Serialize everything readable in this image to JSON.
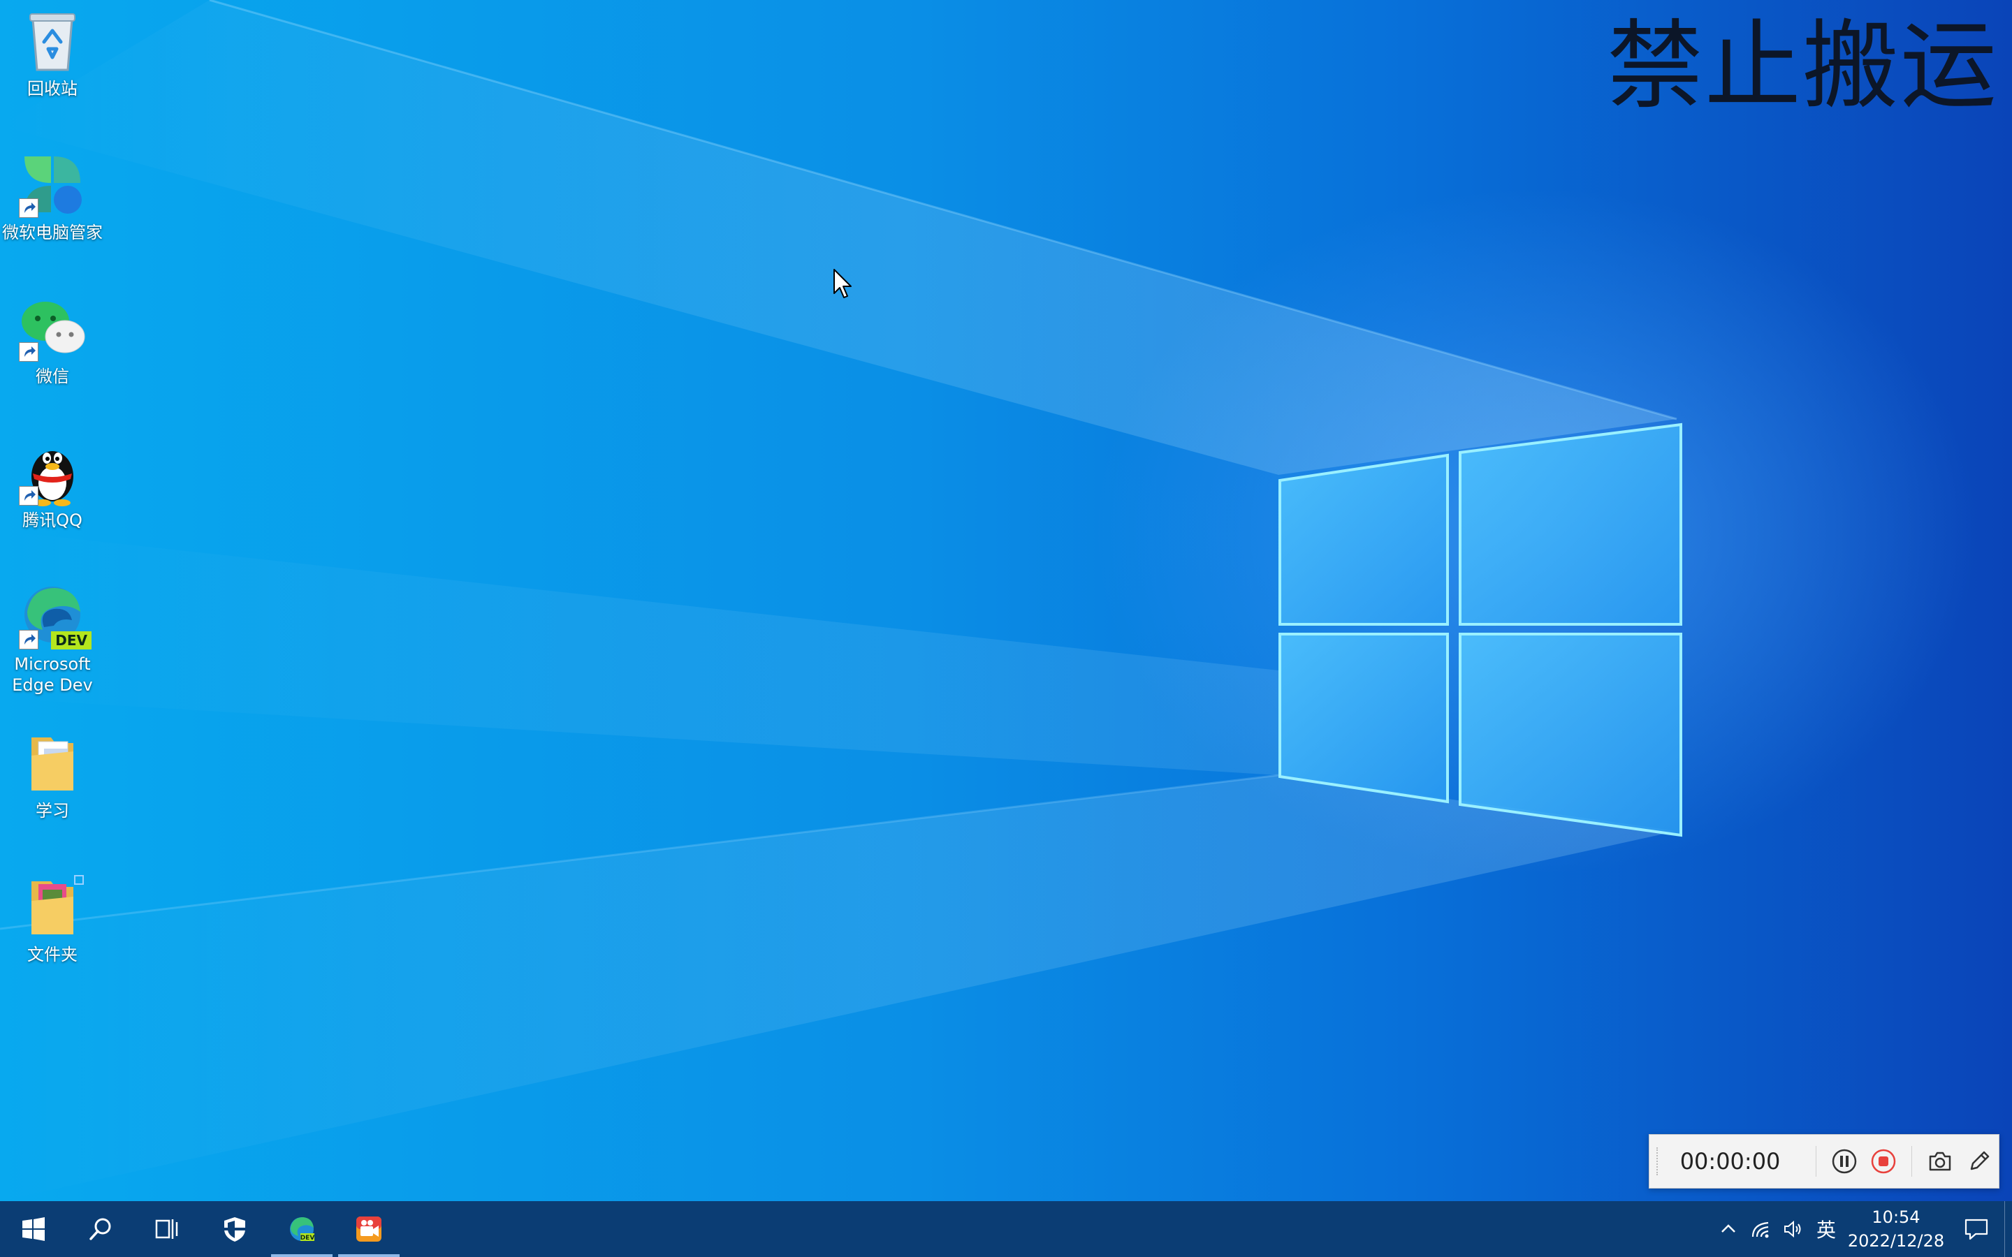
{
  "watermark": "禁止搬运",
  "desktop_icons": [
    {
      "label": "回收站",
      "icon": "recycle-bin-icon",
      "shortcut": false
    },
    {
      "label": "微软电脑管家",
      "icon": "pc-manager-icon",
      "shortcut": true
    },
    {
      "label": "微信",
      "icon": "wechat-icon",
      "shortcut": true
    },
    {
      "label": "腾讯QQ",
      "icon": "qq-penguin-icon",
      "shortcut": true
    },
    {
      "label": "Microsoft Edge Dev",
      "icon": "edge-dev-icon",
      "shortcut": true,
      "badge": "DEV"
    },
    {
      "label": "学习",
      "icon": "folder-icon",
      "shortcut": false
    },
    {
      "label": "文件夹",
      "icon": "folder-icon",
      "shortcut": false
    }
  ],
  "recorder": {
    "time": "00:00:00",
    "buttons": [
      "pause-icon",
      "stop-icon",
      "camera-icon",
      "pencil-icon"
    ],
    "stop_color": "#e8413c"
  },
  "taskbar": {
    "buttons": [
      {
        "icon": "windows-start-icon",
        "running": false
      },
      {
        "icon": "search-icon",
        "running": false
      },
      {
        "icon": "task-view-icon",
        "running": false
      },
      {
        "icon": "security-shield-icon",
        "running": false
      },
      {
        "icon": "edge-dev-icon",
        "running": true,
        "badge": "DEV"
      },
      {
        "icon": "video-recorder-icon",
        "running": true
      }
    ],
    "tray": {
      "icons": [
        "chevron-up-icon",
        "network-icon",
        "volume-icon"
      ],
      "ime": "英",
      "time": "10:54",
      "date": "2022/12/28"
    }
  },
  "colors": {
    "taskbar": "#0b3d74",
    "desktop_left": "#08a9ef",
    "desktop_right": "#0a44b8"
  }
}
